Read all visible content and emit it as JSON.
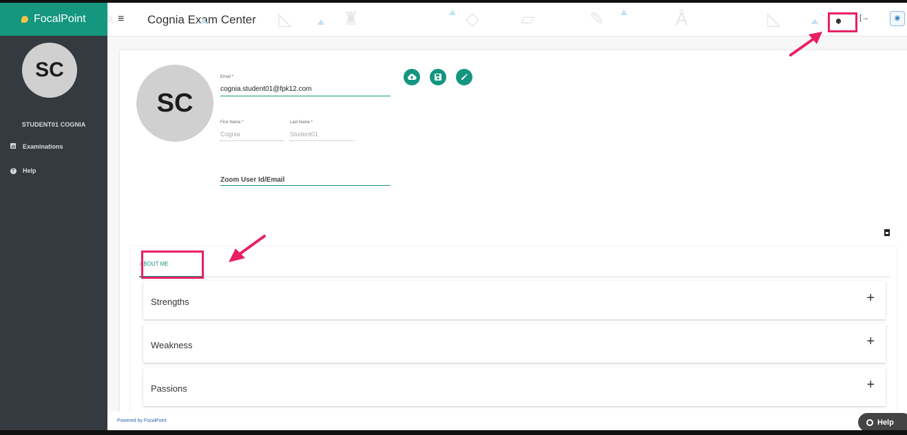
{
  "brand": {
    "name": "FocalPoint"
  },
  "sidebar": {
    "avatar_initials": "SC",
    "user_name": "STUDENT01 COGNIA",
    "items": [
      {
        "label": "Examinations",
        "icon": "chart-icon"
      },
      {
        "label": "Help",
        "icon": "help-icon"
      }
    ]
  },
  "header": {
    "title": "Cognia Exam Center",
    "hamburger": "≡"
  },
  "profile": {
    "avatar_initials": "SC",
    "email_label": "Email *",
    "email_value": "cognia.student01@fpk12.com",
    "first_name_label": "First Name *",
    "first_name_value": "Cognia",
    "last_name_label": "Last Name *",
    "last_name_value": "Student01",
    "zoom_label": "Zoom User Id/Email",
    "actions": [
      "upload-icon",
      "save-icon",
      "edit-icon"
    ]
  },
  "about": {
    "tab_label": "ABOUT ME",
    "sections": [
      "Strengths",
      "Weakness",
      "Passions"
    ]
  },
  "footer": {
    "powered_by": "Powered by FocalPoint"
  },
  "help_button": {
    "label": "Help"
  },
  "colors": {
    "brand": "#14967f",
    "sidebar": "#343a40",
    "highlight": "#ea1e63"
  }
}
